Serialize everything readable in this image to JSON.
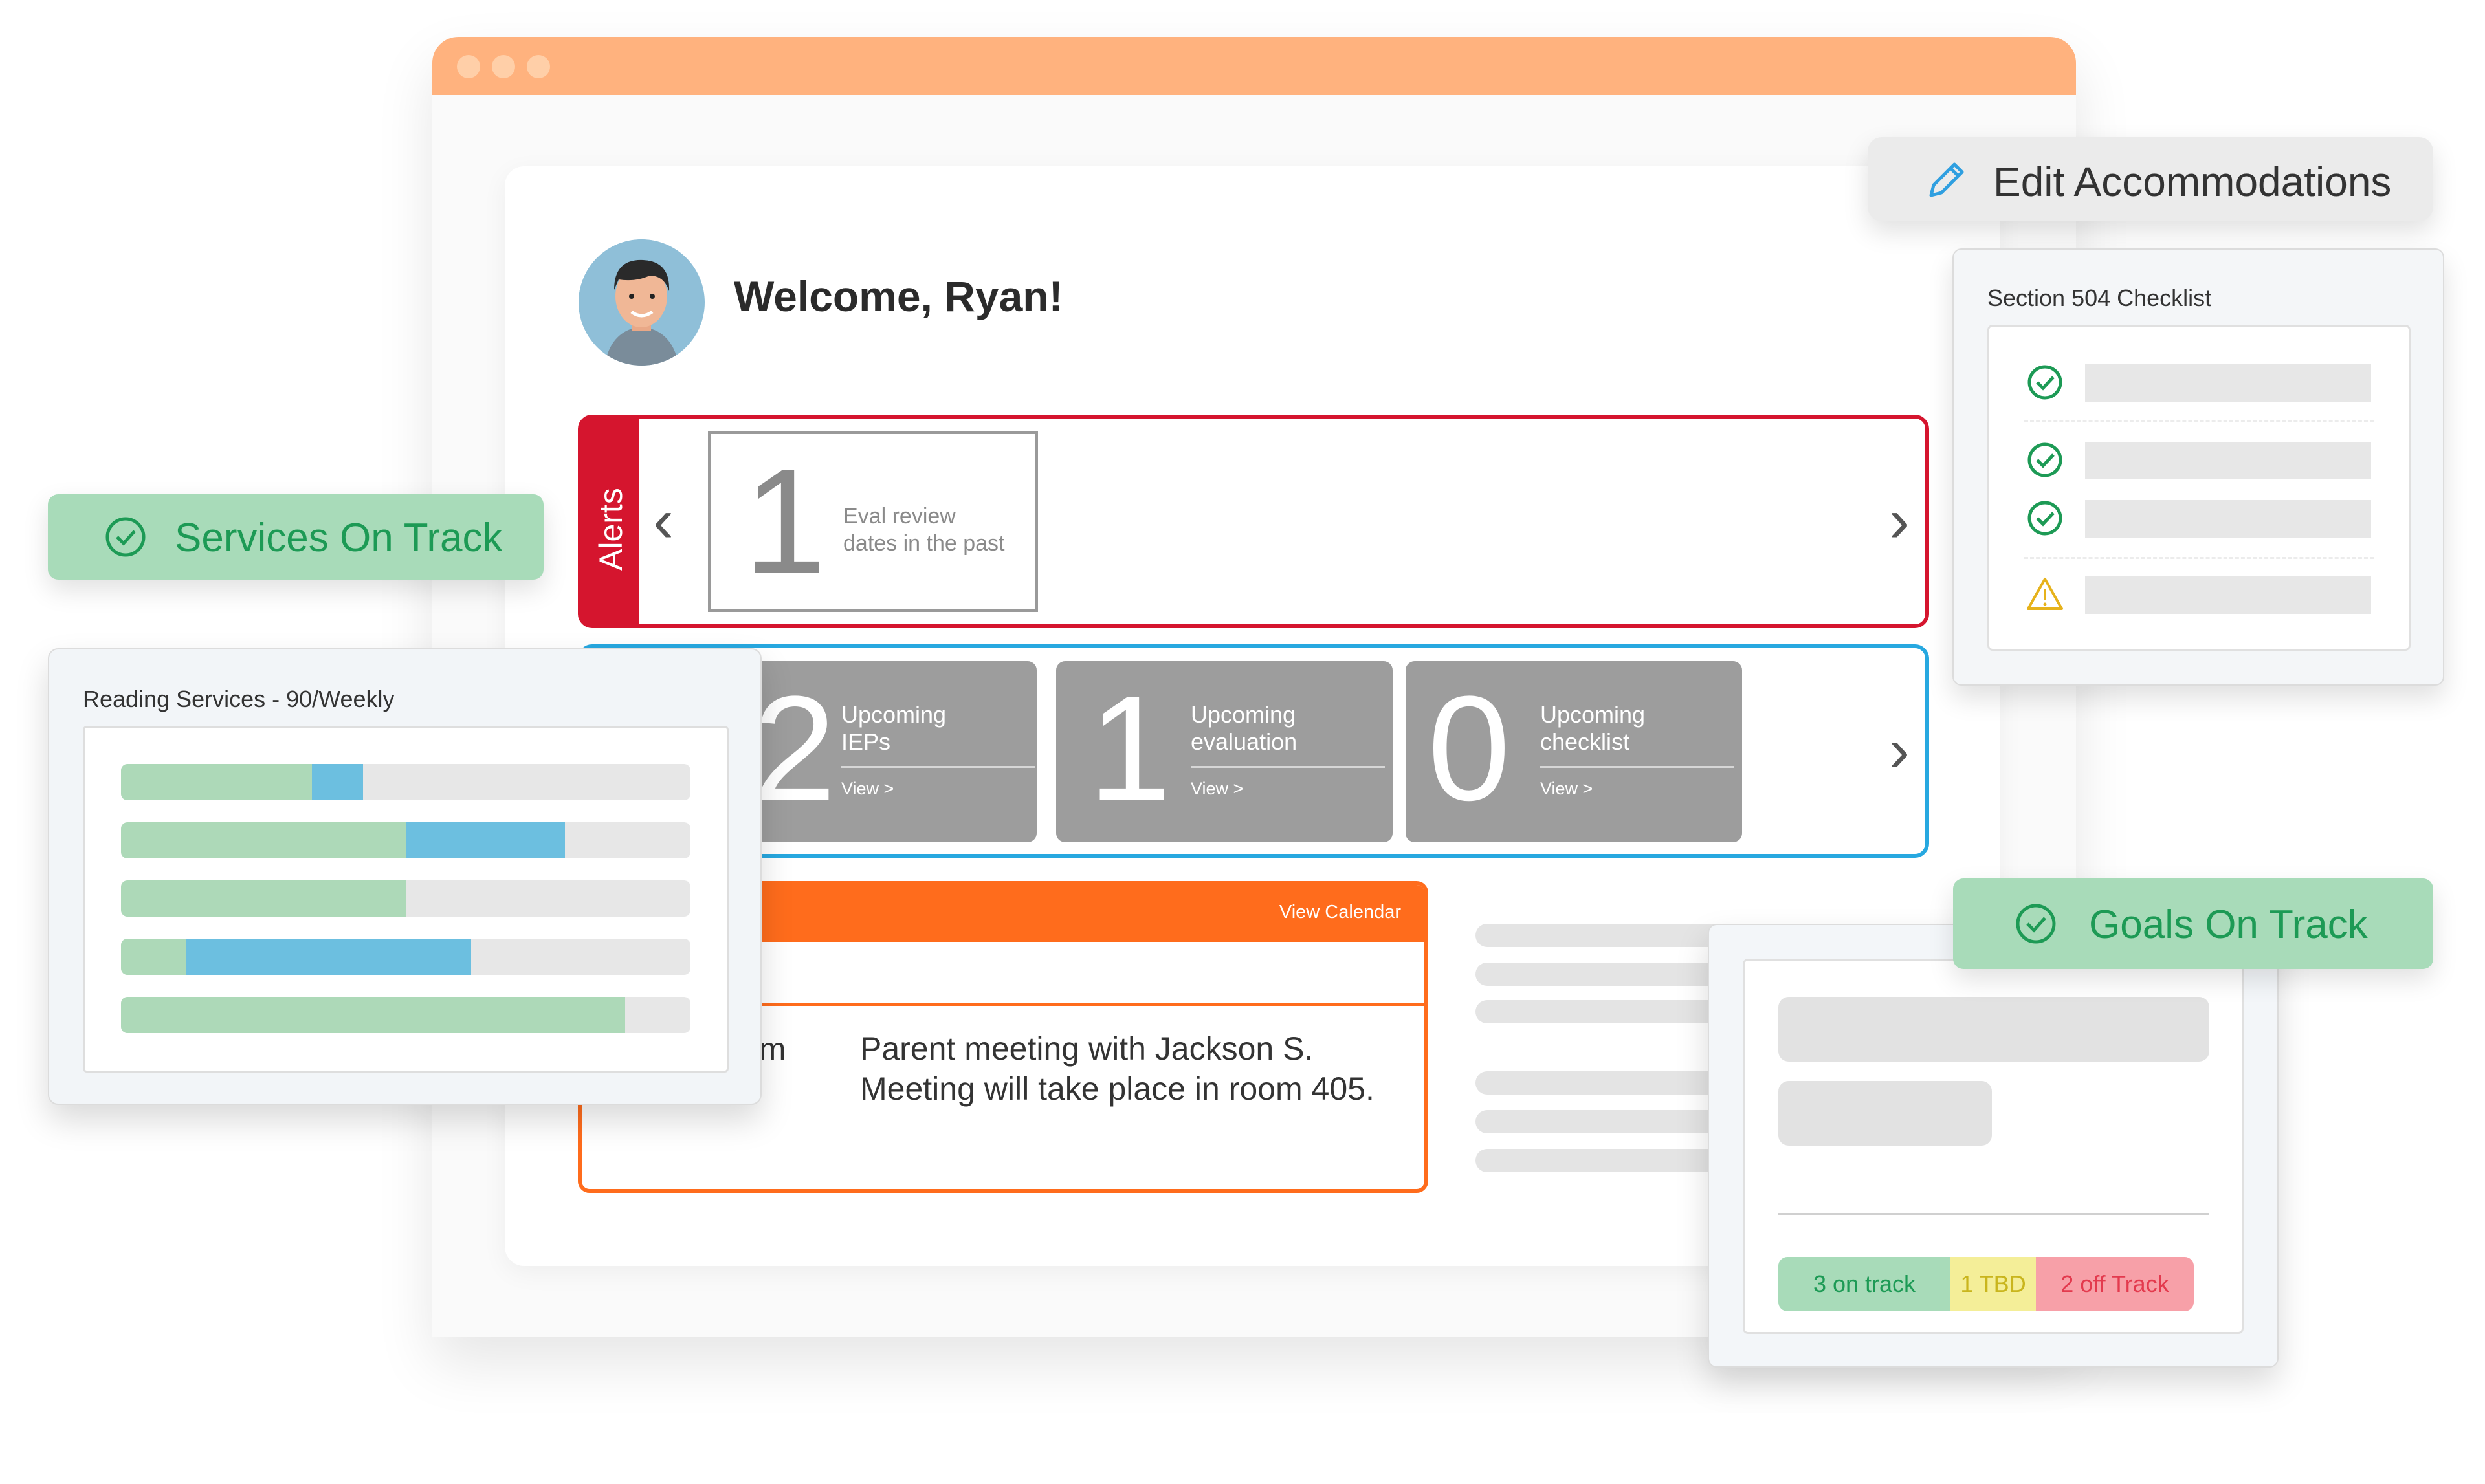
{
  "browser": {
    "titlebar_color": "#ffb27e",
    "window_dots": [
      "dot-1",
      "dot-2",
      "dot-3"
    ]
  },
  "dashboard": {
    "welcome": "Welcome, Ryan!",
    "avatar": "user-avatar"
  },
  "alerts": {
    "label": "Alerts",
    "color": "#d5152e",
    "card": {
      "number": "1",
      "text_line1": "Eval review",
      "text_line2": "dates in the past"
    }
  },
  "upcoming": {
    "color": "#27a8e0",
    "cards": [
      {
        "number": "2",
        "line1": "Upcoming",
        "line2": "IEPs",
        "link": "View >"
      },
      {
        "number": "1",
        "line1": "Upcoming",
        "line2": "evaluation",
        "link": "View >"
      },
      {
        "number": "0",
        "line1": "Upcoming",
        "line2": "checklist",
        "link": "View >"
      }
    ]
  },
  "calendar": {
    "color": "#ff6c1c",
    "link": "View Calendar",
    "time_partial": "om",
    "event_line1": "Parent meeting with Jackson S.",
    "event_line2": "Meeting will take place in room 405."
  },
  "edit_accommodations": {
    "label": "Edit Accommodations",
    "icon": "pencil-icon"
  },
  "section504": {
    "title": "Section 504 Checklist",
    "items": [
      {
        "status": "complete",
        "icon": "check-circle-icon"
      },
      {
        "status": "complete",
        "icon": "check-circle-icon"
      },
      {
        "status": "complete",
        "icon": "check-circle-icon"
      },
      {
        "status": "warning",
        "icon": "warning-triangle-icon"
      }
    ]
  },
  "services_badge": {
    "label": "Services On Track",
    "icon": "check-circle-icon"
  },
  "reading_services": {
    "title": "Reading Services - 90/Weekly",
    "colors": {
      "green": "#add9b8",
      "blue": "#6cbfe0",
      "track": "#e7e7e7"
    },
    "bars": [
      {
        "green": 0.335,
        "blue": 0.09
      },
      {
        "green": 0.5,
        "blue": 0.28
      },
      {
        "green": 0.5,
        "blue": 0.0
      },
      {
        "green": 0.115,
        "blue": 0.5
      },
      {
        "green": 0.885,
        "blue": 0.0
      }
    ]
  },
  "goals_badge": {
    "label": "Goals On Track",
    "icon": "check-circle-icon"
  },
  "goals_status": [
    {
      "label": "3 on track",
      "bg": "#a8dbb9",
      "color": "#1d9a55"
    },
    {
      "label": "1 TBD",
      "bg": "#f4ee98",
      "color": "#c9b51d"
    },
    {
      "label": "2 off Track",
      "bg": "#f7a0a8",
      "color": "#e33a4e"
    }
  ]
}
